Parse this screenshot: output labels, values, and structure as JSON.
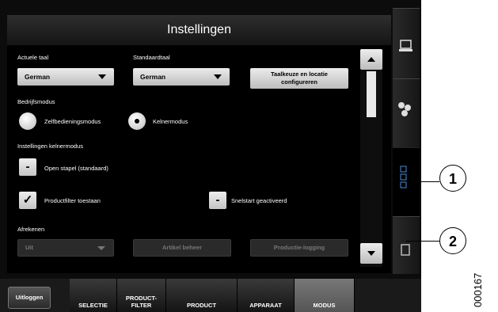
{
  "title": "Instellingen",
  "language": {
    "current_label": "Actuele taal",
    "current_value": "German",
    "default_label": "Standaardtaal",
    "default_value": "German",
    "configure_button": "Taalkeuze en locatie configureren"
  },
  "business_mode": {
    "label": "Bedrijfsmodus",
    "options": [
      {
        "label": "Zelfbedieningsmodus",
        "selected": false
      },
      {
        "label": "Kelnermodus",
        "selected": true
      }
    ]
  },
  "waiter_settings": {
    "label": "Instellingen kelnermodus",
    "open_stack_label": "Open stapel (standaard)",
    "open_stack_symbol": "-",
    "product_filter_label": "Productfilter toestaan",
    "product_filter_symbol": "✓",
    "quickstart_label": "Snelstart geactiveerd",
    "quickstart_symbol": "-"
  },
  "checkout": {
    "label": "Afrekenen",
    "value": "Uit",
    "article_button": "Artikel beheer",
    "logging_button": "Productie-logging"
  },
  "bottom_tabs": {
    "logout": "Uitloggen",
    "tabs": [
      "SELECTIE",
      "PRODUCT-\nFILTER",
      "PRODUCT",
      "APPARAAT",
      "MODUS"
    ]
  },
  "callouts": [
    "1",
    "2"
  ],
  "figure_code": "000167",
  "colors": {
    "accent_active_tab": "#666666",
    "background": "#000000"
  }
}
